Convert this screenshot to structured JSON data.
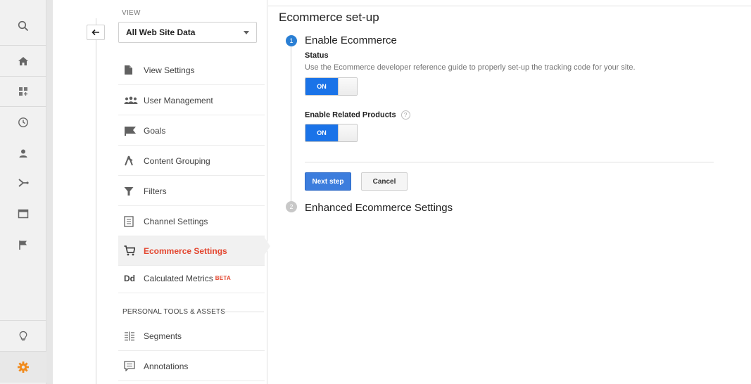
{
  "rail": {
    "icons": [
      "search-icon",
      "home-icon",
      "customization-icon",
      "realtime-clock-icon",
      "audience-person-icon",
      "acquisition-icon",
      "behavior-icon",
      "conversions-flag-icon",
      "discover-lightbulb-icon",
      "admin-gear-icon"
    ],
    "active_color": "#f18b1c"
  },
  "view": {
    "label": "VIEW",
    "selected": "All Web Site Data"
  },
  "nav": {
    "items": [
      {
        "label": "View Settings",
        "icon": "document-icon"
      },
      {
        "label": "User Management",
        "icon": "users-icon"
      },
      {
        "label": "Goals",
        "icon": "flag-icon"
      },
      {
        "label": "Content Grouping",
        "icon": "content-grouping-icon"
      },
      {
        "label": "Filters",
        "icon": "filter-icon"
      },
      {
        "label": "Channel Settings",
        "icon": "channel-settings-icon"
      },
      {
        "label": "Ecommerce Settings",
        "icon": "cart-icon"
      },
      {
        "label": "Calculated Metrics",
        "icon": "dd-icon",
        "badge": "BETA"
      }
    ],
    "section_label": "PERSONAL TOOLS & ASSETS",
    "tools": [
      {
        "label": "Segments",
        "icon": "segments-icon"
      },
      {
        "label": "Annotations",
        "icon": "annotations-icon"
      }
    ],
    "dd_glyph": "Dd"
  },
  "main": {
    "title": "Ecommerce set-up",
    "step1": {
      "number": "1",
      "title": "Enable Ecommerce",
      "status_label": "Status",
      "status_desc": "Use the Ecommerce developer reference guide to properly set-up the tracking code for your site.",
      "status_toggle": "ON",
      "related_label": "Enable Related Products",
      "related_help": "?",
      "related_toggle": "ON",
      "next_button": "Next step",
      "cancel_button": "Cancel"
    },
    "step2": {
      "number": "2",
      "title": "Enhanced Ecommerce Settings"
    }
  },
  "colors": {
    "accent_blue": "#1a73e8",
    "active_red": "#e3462f",
    "step_active": "#2a7fd4"
  }
}
